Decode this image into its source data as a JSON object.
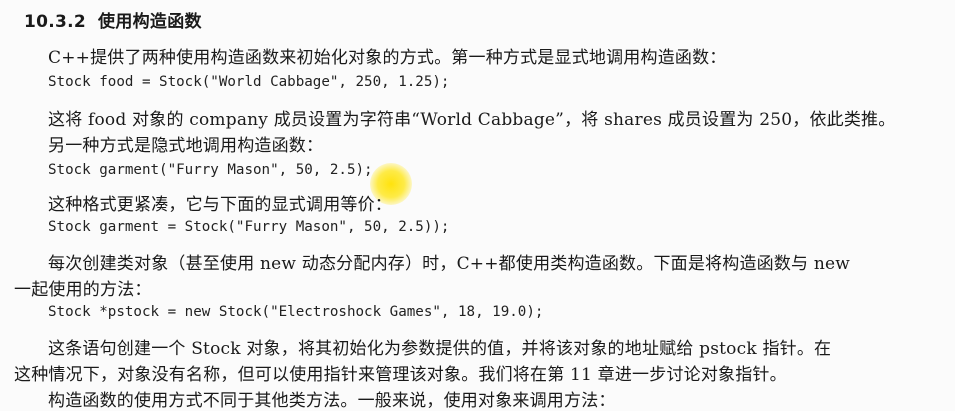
{
  "section": {
    "number": "10.3.2",
    "title": "使用构造函数"
  },
  "lines": {
    "p1": "C++提供了两种使用构造函数来初始化对象的方式。第一种方式是显式地调用构造函数：",
    "code1": "Stock food = Stock(\"World Cabbage\", 250, 1.25);",
    "p2": "这将 food 对象的 company 成员设置为字符串“World Cabbage”，将 shares 成员设置为 250，依此类推。",
    "p3": "另一种方式是隐式地调用构造函数：",
    "code2": "Stock garment(\"Furry Mason\", 50, 2.5);",
    "p4": "这种格式更紧凑，它与下面的显式调用等价：",
    "code3": "Stock garment = Stock(\"Furry Mason\", 50, 2.5));",
    "p5a": "每次创建类对象（甚至使用 new 动态分配内存）时，C++都使用类构造函数。下面是将构造函数与 new",
    "p5b": "一起使用的方法：",
    "code4": "Stock *pstock = new Stock(\"Electroshock Games\", 18, 19.0);",
    "p6a": "这条语句创建一个 Stock 对象，将其初始化为参数提供的值，并将该对象的地址赋给 pstock 指针。在",
    "p6b": "这种情况下，对象没有名称，但可以使用指针来管理该对象。我们将在第 11 章进一步讨论对象指针。",
    "p7": "构造函数的使用方式不同于其他类方法。一般来说，使用对象来调用方法："
  },
  "colors": {
    "cursor_highlight": "#ffe100"
  }
}
